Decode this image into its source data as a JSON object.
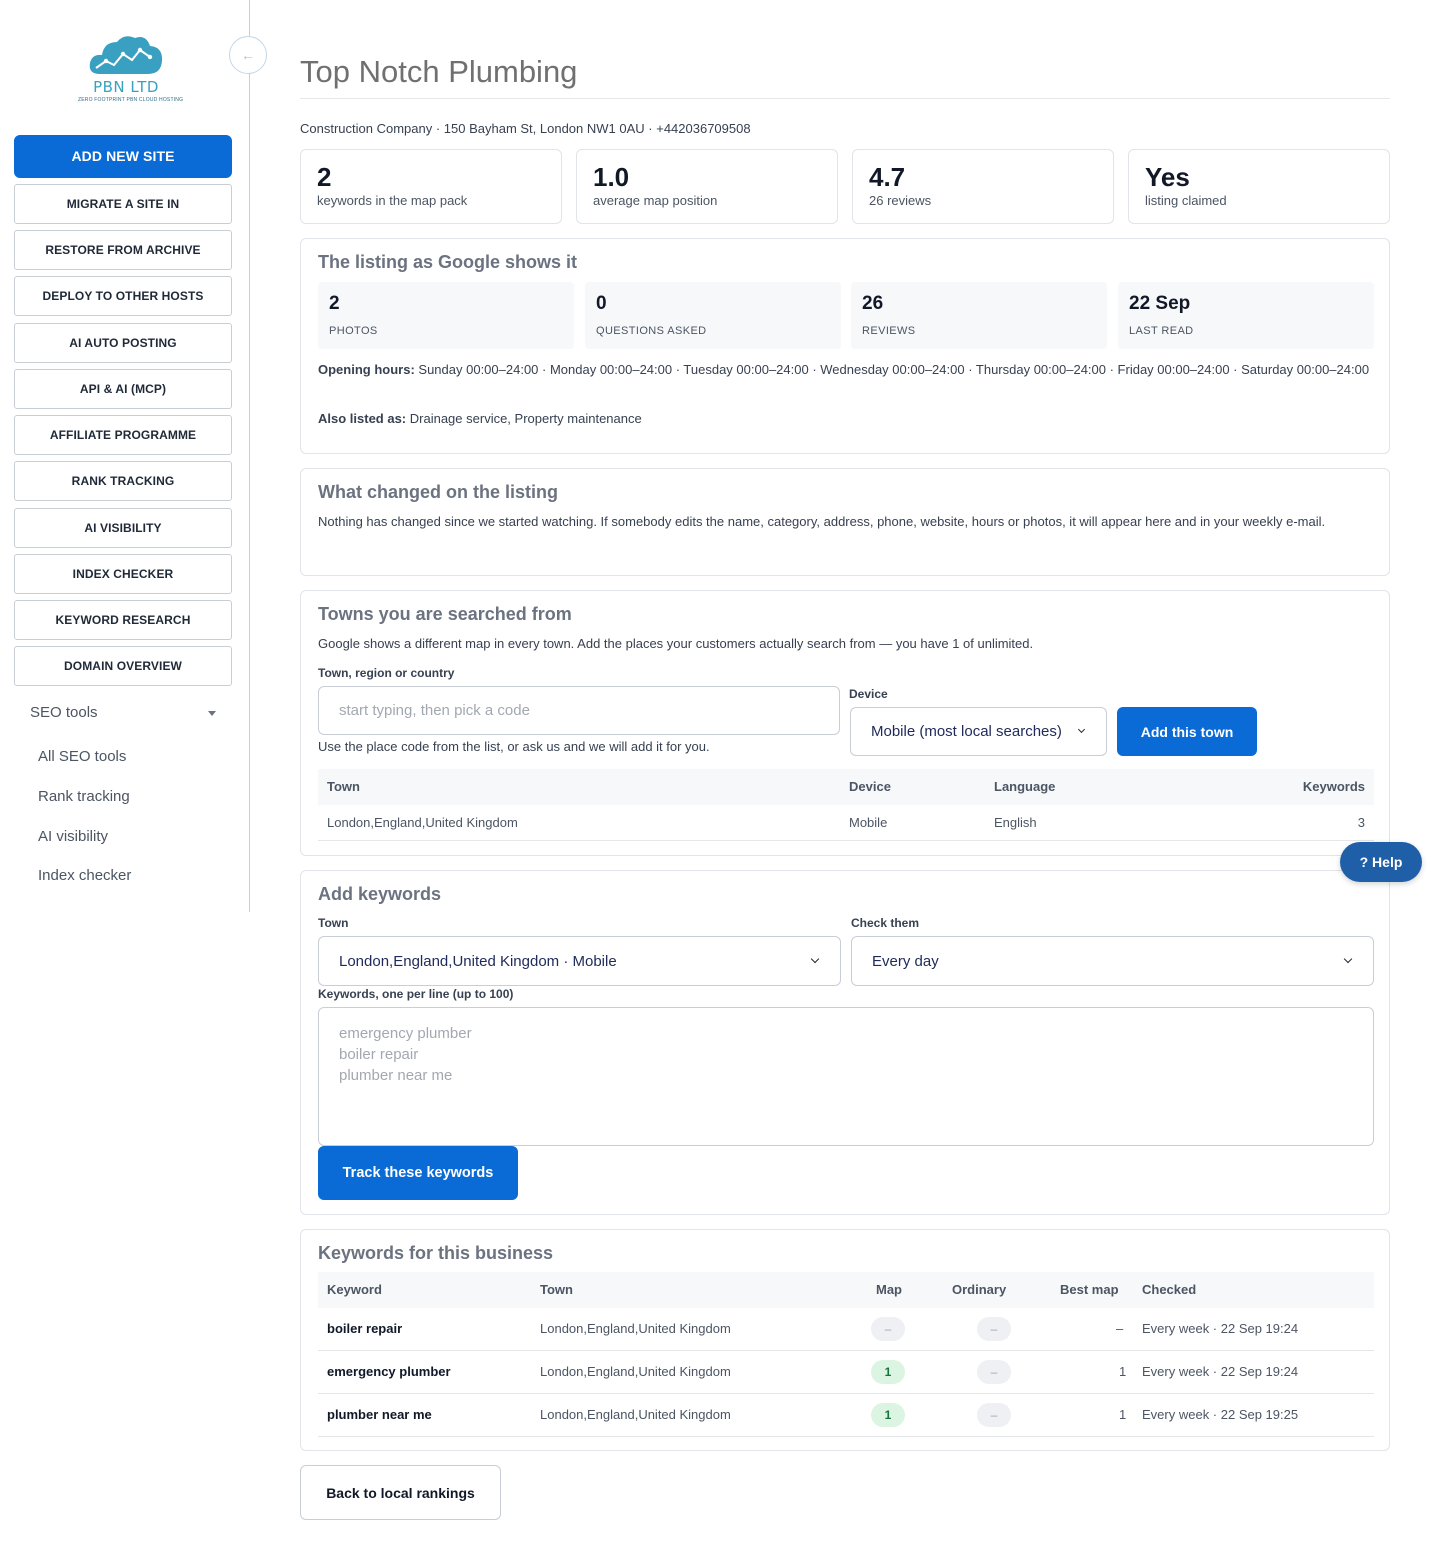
{
  "brand": {
    "name": "PBN LTD",
    "tagline": "ZERO FOOTPRINT PBN CLOUD HOSTING",
    "accent": "#0a6bd6",
    "logo_color": "#3aa0c2"
  },
  "sidebar": {
    "collapse_icon": "arrow-left-icon",
    "buttons": [
      {
        "label": "ADD NEW SITE"
      },
      {
        "label": "MIGRATE A SITE IN"
      },
      {
        "label": "RESTORE FROM ARCHIVE"
      },
      {
        "label": "DEPLOY TO OTHER HOSTS"
      },
      {
        "label": "AI AUTO POSTING"
      },
      {
        "label": "API & AI (MCP)"
      },
      {
        "label": "AFFILIATE PROGRAMME"
      },
      {
        "label": "RANK TRACKING"
      },
      {
        "label": "AI VISIBILITY"
      },
      {
        "label": "INDEX CHECKER"
      },
      {
        "label": "KEYWORD RESEARCH"
      },
      {
        "label": "DOMAIN OVERVIEW"
      }
    ],
    "seo_tools": {
      "label": "SEO tools",
      "items": [
        "All SEO tools",
        "Rank tracking",
        "AI visibility",
        "Index checker"
      ]
    }
  },
  "header": {
    "title": "Top Notch Plumbing",
    "subline": "Construction Company · 150 Bayham St, London NW1 0AU · +442036709508"
  },
  "stats": [
    {
      "value": "2",
      "label": "keywords in the map pack"
    },
    {
      "value": "1.0",
      "label": "average map position"
    },
    {
      "value": "4.7",
      "label": "26 reviews"
    },
    {
      "value": "Yes",
      "label": "listing claimed"
    }
  ],
  "listing": {
    "title": "The listing as Google shows it",
    "cards": [
      {
        "value": "2",
        "label": "PHOTOS"
      },
      {
        "value": "0",
        "label": "QUESTIONS ASKED"
      },
      {
        "value": "26",
        "label": "REVIEWS"
      },
      {
        "value": "22 Sep",
        "label": "LAST READ"
      }
    ],
    "hours_label": "Opening hours:",
    "hours": "Sunday 00:00–24:00 · Monday 00:00–24:00 · Tuesday 00:00–24:00 · Wednesday 00:00–24:00 · Thursday 00:00–24:00 · Friday 00:00–24:00 · Saturday 00:00–24:00",
    "also_label": "Also listed as:",
    "also": "Drainage service, Property maintenance"
  },
  "changes": {
    "title": "What changed on the listing",
    "text": "Nothing has changed since we started watching. If somebody edits the name, category, address, phone, website, hours or photos, it will appear here and in your weekly e-mail."
  },
  "towns": {
    "title": "Towns you are searched from",
    "description": "Google shows a different map in every town. Add the places your customers actually search from — you have 1 of unlimited.",
    "town_label": "Town, region or country",
    "town_placeholder": "start typing, then pick a code",
    "town_help": "Use the place code from the list, or ask us and we will add it for you.",
    "device_label": "Device",
    "device_value": "Mobile (most local searches)",
    "add_button": "Add this town",
    "columns": [
      "Town",
      "Device",
      "Language",
      "Keywords"
    ],
    "rows": [
      {
        "town": "London,England,United Kingdom",
        "device": "Mobile",
        "language": "English",
        "keywords": "3"
      }
    ]
  },
  "add_keywords": {
    "title": "Add keywords",
    "town_label": "Town",
    "town_value": "London,England,United Kingdom · Mobile",
    "check_label": "Check them",
    "check_value": "Every day",
    "keywords_label": "Keywords, one per line (up to 100)",
    "keywords_placeholder": "emergency plumber\nboiler repair\nplumber near me",
    "submit": "Track these keywords"
  },
  "keywords_table": {
    "title": "Keywords for this business",
    "columns": [
      "Keyword",
      "Town",
      "Map",
      "Ordinary",
      "Best map",
      "Checked"
    ],
    "rows": [
      {
        "keyword": "boiler repair",
        "town": "London,England,United Kingdom",
        "map": "–",
        "ordinary": "–",
        "best": "–",
        "checked": "Every week · 22 Sep 19:24"
      },
      {
        "keyword": "emergency plumber",
        "town": "London,England,United Kingdom",
        "map": "1",
        "ordinary": "–",
        "best": "1",
        "checked": "Every week · 22 Sep 19:24"
      },
      {
        "keyword": "plumber near me",
        "town": "London,England,United Kingdom",
        "map": "1",
        "ordinary": "–",
        "best": "1",
        "checked": "Every week · 22 Sep 19:25"
      }
    ]
  },
  "help_button": "? Help",
  "back_button": "Back to local rankings"
}
